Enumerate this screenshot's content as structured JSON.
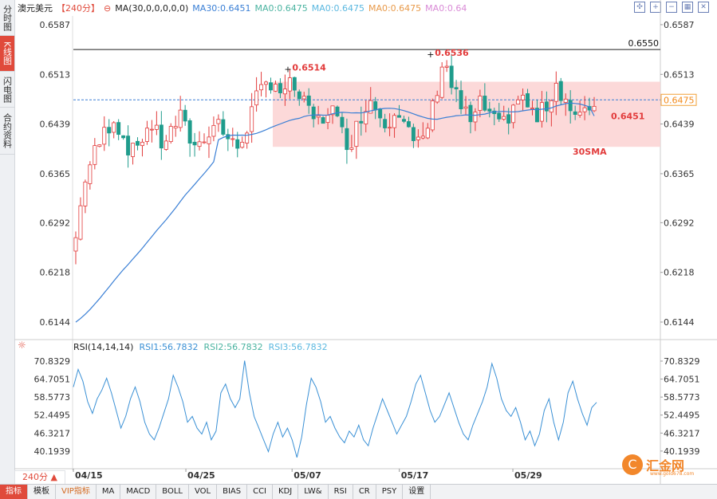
{
  "sidebar": {
    "tabs": [
      {
        "label": "分时图",
        "active": false
      },
      {
        "label": "K线图",
        "active": true
      },
      {
        "label": "闪电图",
        "active": false
      },
      {
        "label": "合约资料",
        "active": false
      }
    ]
  },
  "legend": {
    "symbol": "澳元美元",
    "period": "【240分】",
    "ma_param": "MA(30,0,0,0,0,0)",
    "items": [
      {
        "label": "MA30:0.6451",
        "color": "#3a7fd5"
      },
      {
        "label": "MA0:0.6475",
        "color": "#4ab3a0"
      },
      {
        "label": "MA0:0.6475",
        "color": "#5bb8e0"
      },
      {
        "label": "MA0:0.6475",
        "color": "#e89a4a"
      },
      {
        "label": "MA0:0.64",
        "color": "#d98ad6"
      }
    ]
  },
  "rsi_legend": {
    "name": "RSI(14,14,14)",
    "items": [
      {
        "label": "RSI1:56.7832",
        "color": "#3a90d5"
      },
      {
        "label": "RSI2:56.7832",
        "color": "#4ab3a0"
      },
      {
        "label": "RSI3:56.7832",
        "color": "#5bb8e0"
      }
    ]
  },
  "toolbar": {
    "icons": [
      "expand-icon",
      "zoom-in-icon",
      "zoom-out-icon",
      "grid-icon",
      "close-icon"
    ]
  },
  "period_selector": "240分 ▲",
  "bottom_tabs": [
    "指标",
    "模板",
    "VIP指标",
    "MA",
    "MACD",
    "BOLL",
    "VOL",
    "BIAS",
    "CCI",
    "KDJ",
    "LW&",
    "RSI",
    "CR",
    "PSY",
    "设置"
  ],
  "logo": {
    "text": "汇金网",
    "sub": "www.gold678.com"
  },
  "colors": {
    "up": "#e23b3b",
    "down": "#1f9c8c",
    "ma30": "#3a7fd5",
    "rsi": "#3a90d5",
    "range_fill": "#fbd2d2",
    "current_price": "#3a7fd5"
  },
  "chart_data": [
    {
      "type": "candlestick",
      "title": "澳元美元",
      "y_ticks": [
        "0.6587",
        "0.6513",
        "0.6439",
        "0.6365",
        "0.6292",
        "0.6218",
        "0.6144"
      ],
      "ylim": [
        0.6125,
        0.66
      ],
      "x_ticks": [
        "04/15",
        "04/25",
        "05/07",
        "05/17",
        "05/29"
      ],
      "candle_count": 110,
      "close_path": [
        0.627,
        0.636,
        0.6395,
        0.6425,
        0.645,
        0.642,
        0.6395,
        0.642,
        0.644,
        0.641,
        0.6425,
        0.645,
        0.642,
        0.6405,
        0.643,
        0.6445,
        0.642,
        0.64,
        0.643,
        0.647,
        0.6495,
        0.6508,
        0.648,
        0.65,
        0.647,
        0.645,
        0.644,
        0.647,
        0.643,
        0.641,
        0.644,
        0.648,
        0.646,
        0.644,
        0.647,
        0.644,
        0.64,
        0.642,
        0.647,
        0.654,
        0.649,
        0.646,
        0.644,
        0.647,
        0.645,
        0.643,
        0.6455,
        0.648,
        0.6465,
        0.6445,
        0.647,
        0.65,
        0.6475,
        0.6448,
        0.6451,
        0.6475
      ],
      "annotations": [
        {
          "label": "0.6514",
          "value": 0.6514,
          "color": "#e23b3b"
        },
        {
          "label": "0.6536",
          "value": 0.6536,
          "color": "#e23b3b"
        },
        {
          "label": "0.6451",
          "value": 0.6451,
          "color": "#e23b3b"
        },
        {
          "label": "30SMA",
          "value": 0.6398,
          "color": "#e23b3b"
        }
      ],
      "horizontal_line": {
        "label": "0.6550",
        "value": 0.655
      },
      "current_price": {
        "label": "0.6475",
        "value": 0.6475
      },
      "range_box": {
        "low": 0.6405,
        "high": 0.6502
      },
      "ma30_end": 0.6451
    },
    {
      "type": "line",
      "name": "RSI",
      "y_ticks": [
        "70.8329",
        "64.7051",
        "58.5773",
        "52.4495",
        "46.3217",
        "40.1939"
      ],
      "ylim": [
        35.0,
        73.0
      ],
      "values": [
        62,
        68,
        64,
        57,
        53,
        58,
        61,
        65,
        60,
        54,
        48,
        52,
        58,
        62,
        57,
        50,
        46,
        44,
        48,
        53,
        58,
        66,
        62,
        57,
        50,
        52,
        48,
        46,
        50,
        44,
        47,
        60,
        63,
        58,
        55,
        58,
        71,
        60,
        52,
        48,
        44,
        40,
        46,
        50,
        45,
        48,
        44,
        38,
        45,
        56,
        65,
        62,
        57,
        50,
        52,
        48,
        45,
        43,
        47,
        45,
        49,
        44,
        42,
        48,
        53,
        58,
        54,
        50,
        46,
        49,
        52,
        57,
        63,
        66,
        60,
        54,
        50,
        52,
        56,
        60,
        55,
        50,
        46,
        44,
        49,
        53,
        57,
        62,
        70,
        65,
        58,
        54,
        52,
        55,
        50,
        44,
        47,
        42,
        46,
        54,
        58,
        50,
        44,
        50,
        60,
        64,
        58,
        53,
        49,
        55,
        56.78
      ]
    }
  ]
}
